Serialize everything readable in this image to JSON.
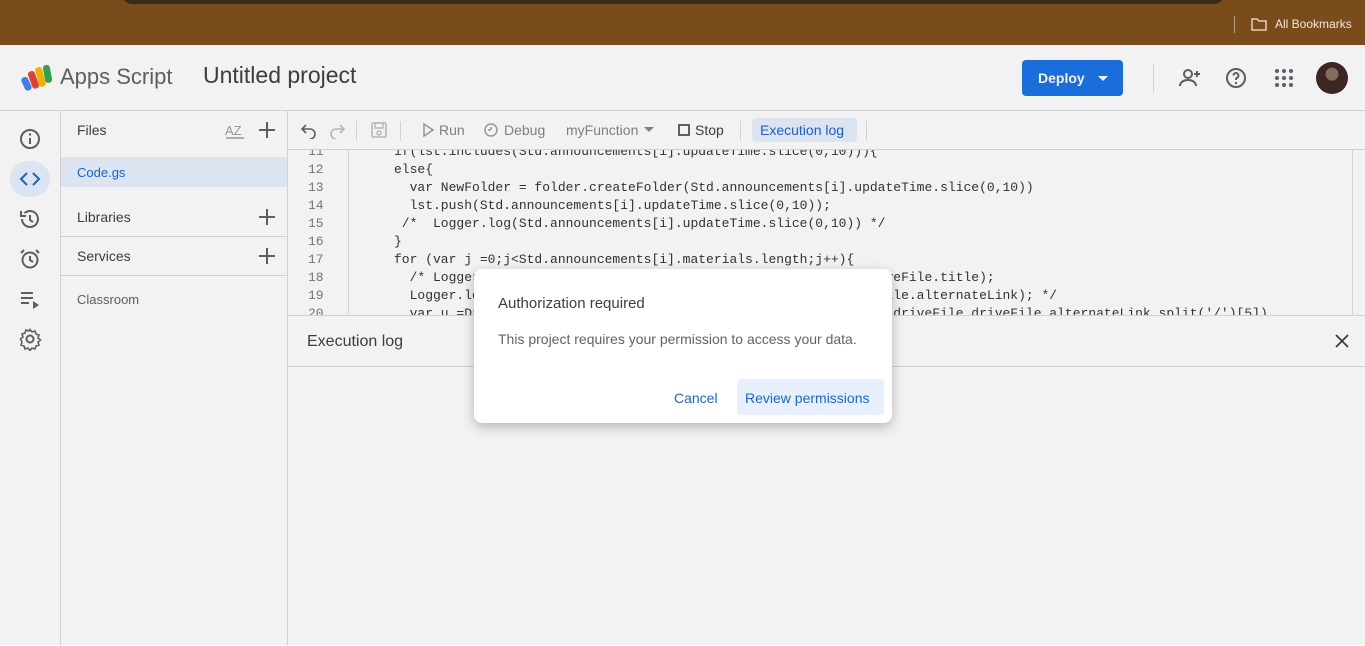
{
  "browser": {
    "bookmarks_label": "All Bookmarks"
  },
  "header": {
    "app_name": "Apps Script",
    "project_name": "Untitled project",
    "deploy_label": "Deploy",
    "icons": [
      "add-person-icon",
      "help-icon",
      "apps-grid-icon"
    ]
  },
  "rail": {
    "icons": [
      "info-icon",
      "code-icon",
      "history-icon",
      "alarm-icon",
      "run-list-icon",
      "settings-icon"
    ]
  },
  "files_panel": {
    "title": "Files",
    "files": [
      "Code.gs"
    ],
    "libraries_label": "Libraries",
    "services_label": "Services",
    "libraries": [
      "Classroom"
    ]
  },
  "toolbar": {
    "run_label": "Run",
    "debug_label": "Debug",
    "function_label": "myFunction",
    "stop_label": "Stop",
    "exec_log_label": "Execution log"
  },
  "editor": {
    "lines": [
      {
        "n": "11",
        "code": "if(lst.includes(Std.announcements[i].updateTime.slice(0,10))){"
      },
      {
        "n": "12",
        "code": "else{"
      },
      {
        "n": "13",
        "code": "  var NewFolder = folder.createFolder(Std.announcements[i].updateTime.slice(0,10))"
      },
      {
        "n": "14",
        "code": "  lst.push(Std.announcements[i].updateTime.slice(0,10));"
      },
      {
        "n": "15",
        "code": " /*  Logger.log(Std.announcements[i].updateTime.slice(0,10)) */"
      },
      {
        "n": "16",
        "code": "}"
      },
      {
        "n": "17",
        "code": "for (var j =0;j<Std.announcements[i].materials.length;j++){"
      },
      {
        "n": "18",
        "code": "  /* Logger.log(Std.announcements[i].materials[j].driveFile.driveFile.title);"
      },
      {
        "n": "19",
        "code": "  Logger.log(Std.announcements[i].materials[j].driveFile.driveFile.alternateLink); */"
      },
      {
        "n": "20",
        "code": "  var u =DriveApp.getFileById(Std.announcements[i].materials[j].driveFile.driveFile.alternateLink.split('/')[5])"
      }
    ]
  },
  "exec_panel": {
    "title": "Execution log"
  },
  "dialog": {
    "title": "Authorization required",
    "body": "This project requires your permission to access your data.",
    "cancel_label": "Cancel",
    "review_label": "Review permissions"
  }
}
